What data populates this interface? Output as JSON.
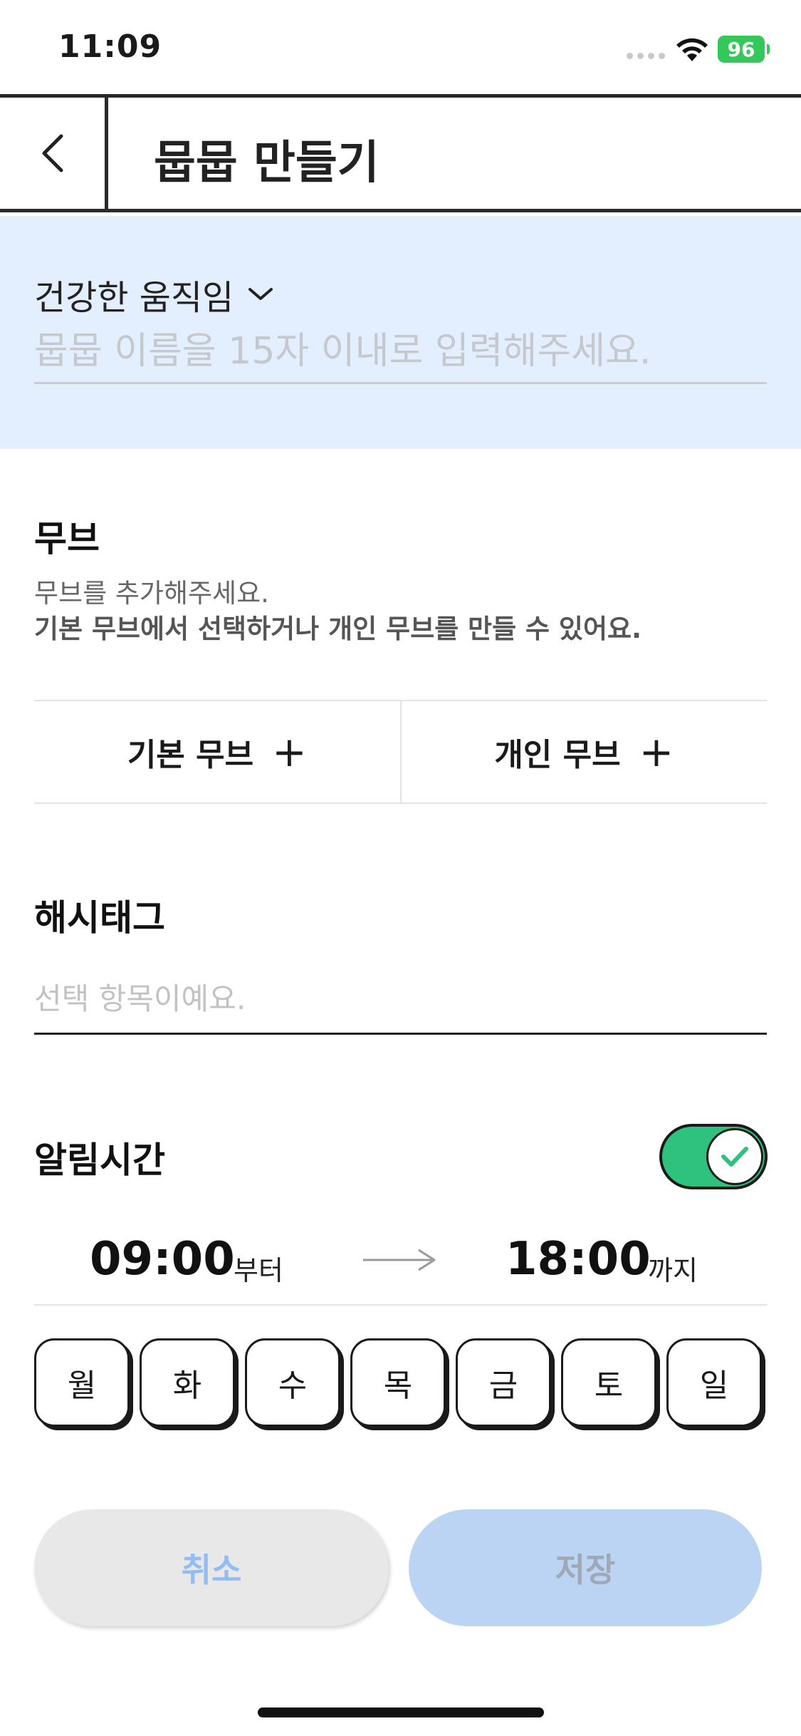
{
  "status_bar": {
    "time": "11:09",
    "battery": "96"
  },
  "nav": {
    "title": "뭅뭅 만들기"
  },
  "name_section": {
    "category": "건강한 움직임",
    "placeholder": "뭅뭅 이름을 15자 이내로 입력해주세요."
  },
  "move": {
    "title": "무브",
    "desc1": "무브를 추가해주세요.",
    "desc2": "기본 무브에서 선택하거나 개인 무브를 만들 수 있어요.",
    "basic_label": "기본 무브",
    "personal_label": "개인 무브",
    "plus": "+"
  },
  "hashtag": {
    "title": "해시태그",
    "placeholder": "선택 항목이예요."
  },
  "alarm": {
    "title": "알림시간",
    "toggle_on": true,
    "start_time": "09:00",
    "start_suffix": "부터",
    "end_time": "18:00",
    "end_suffix": "까지",
    "days": [
      "월",
      "화",
      "수",
      "목",
      "금",
      "토",
      "일"
    ]
  },
  "buttons": {
    "cancel": "취소",
    "save": "저장"
  },
  "colors": {
    "accent": "#2ec27e",
    "header_bg": "#e3efff",
    "save_bg": "#bcd4f4"
  },
  "icons": {
    "back": "chevron-left-icon",
    "dropdown": "chevron-down-icon",
    "toggle": "check-icon",
    "arrow": "arrow-right-icon"
  }
}
